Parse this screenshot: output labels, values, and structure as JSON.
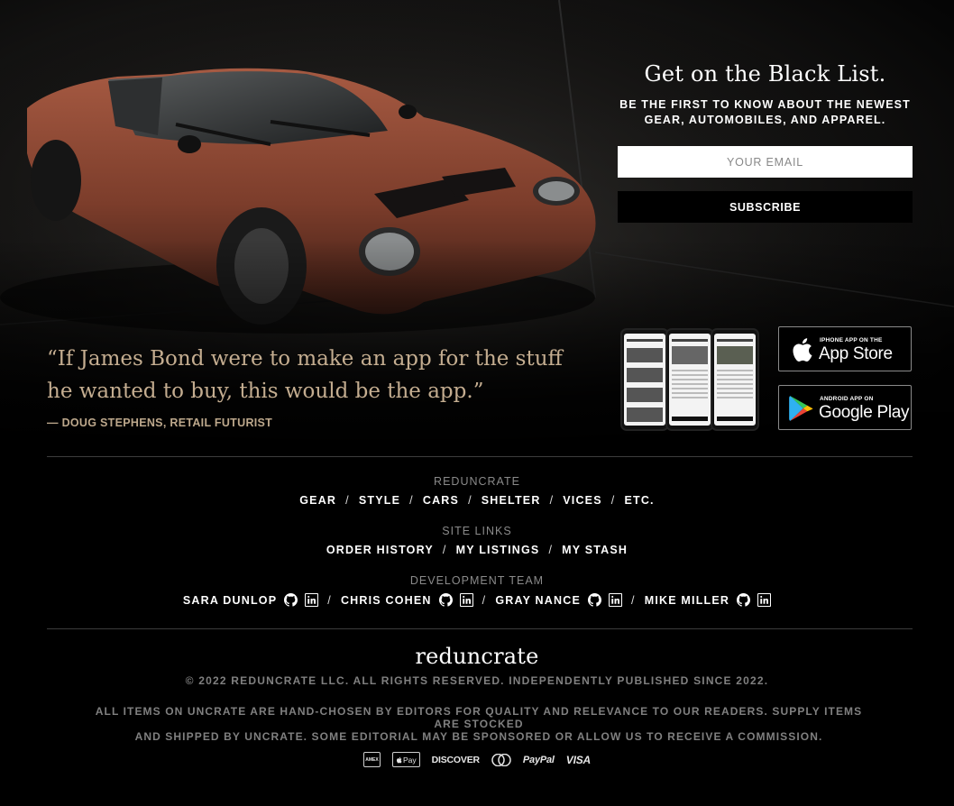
{
  "signup": {
    "title": "Get on the Black List.",
    "subtitle_line1": "BE THE FIRST TO KNOW ABOUT THE NEWEST",
    "subtitle_line2": "GEAR, AUTOMOBILES, AND APPAREL.",
    "email_placeholder": "YOUR EMAIL",
    "subscribe_label": "SUBSCRIBE"
  },
  "quote": {
    "text_line1": "“If James Bond were to make an app for the stuff",
    "text_line2": "he wanted to buy, this would be the app.”",
    "author": "— DOUG STEPHENS, RETAIL FUTURIST"
  },
  "app_badges": {
    "ios_small": "IPHONE APP ON THE",
    "ios_big": "App Store",
    "android_small": "ANDROID APP ON",
    "android_big": "Google Play"
  },
  "footer": {
    "categories_label": "REDUNCRATE",
    "categories": [
      "GEAR",
      "STYLE",
      "CARS",
      "SHELTER",
      "VICES",
      "ETC."
    ],
    "site_links_label": "SITE LINKS",
    "site_links": [
      "ORDER HISTORY",
      "MY LISTINGS",
      "MY STASH"
    ],
    "dev_team_label": "DEVELOPMENT TEAM",
    "dev_team": [
      "SARA DUNLOP",
      "CHRIS COHEN",
      "GRAY NANCE",
      "MIKE MILLER"
    ],
    "separator": "/",
    "brand": "reduncrate",
    "copyright": "© 2022 REDUNCRATE LLC. ALL RIGHTS RESERVED. INDEPENDENTLY PUBLISHED SINCE 2022.",
    "disclaimer_line1": "ALL ITEMS ON UNCRATE ARE HAND-CHOSEN BY EDITORS FOR QUALITY AND RELEVANCE TO OUR READERS. SUPPLY ITEMS ARE STOCKED",
    "disclaimer_line2": "AND SHIPPED BY UNCRATE. SOME EDITORIAL MAY BE SPONSORED OR ALLOW US TO RECEIVE A COMMISSION."
  },
  "payments": {
    "amex": "AMEX",
    "applepay": "Pay",
    "discover": "DISCOVER",
    "paypal": "PayPal",
    "visa": "VISA"
  },
  "icons": [
    "apple-icon",
    "google-play-icon",
    "github-icon",
    "linkedin-icon",
    "mastercard-icon"
  ]
}
